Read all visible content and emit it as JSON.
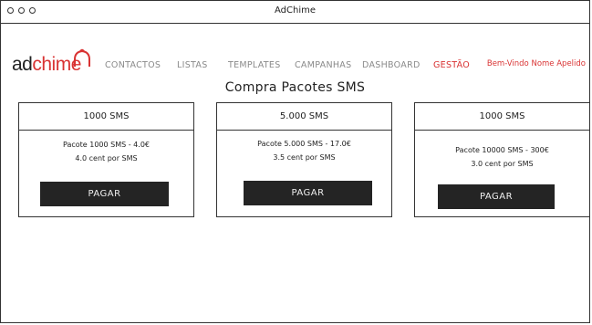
{
  "window": {
    "title": "AdChime"
  },
  "logo": {
    "part1": "ad",
    "part2": "chime"
  },
  "nav": {
    "items": [
      "CONTACTOS",
      "LISTAS",
      "TEMPLATES",
      "CAMPANHAS",
      "DASHBOARD",
      "GESTÃO"
    ],
    "active_index": 5,
    "welcome": "Bem-Vindo Nome Apelido"
  },
  "page": {
    "title": "Compra Pacotes SMS"
  },
  "cards": [
    {
      "header": "1000 SMS",
      "line1": "Pacote 1000 SMS - 4.0€",
      "line2": "4.0 cent por SMS",
      "button": "PAGAR"
    },
    {
      "header": "5.000 SMS",
      "line1": "Pacote 5.000 SMS - 17.0€",
      "line2": "3.5 cent por SMS",
      "button": "PAGAR"
    },
    {
      "header": "1000 SMS",
      "line1": "Pacote 10000 SMS - 300€",
      "line2": "3.0 cent por SMS",
      "button": "PAGAR"
    }
  ],
  "colors": {
    "accent": "#d93333",
    "nav_inactive": "#8a8a8a",
    "button_bg": "#242424"
  },
  "icons": {
    "logo_bell": "bell-icon"
  }
}
